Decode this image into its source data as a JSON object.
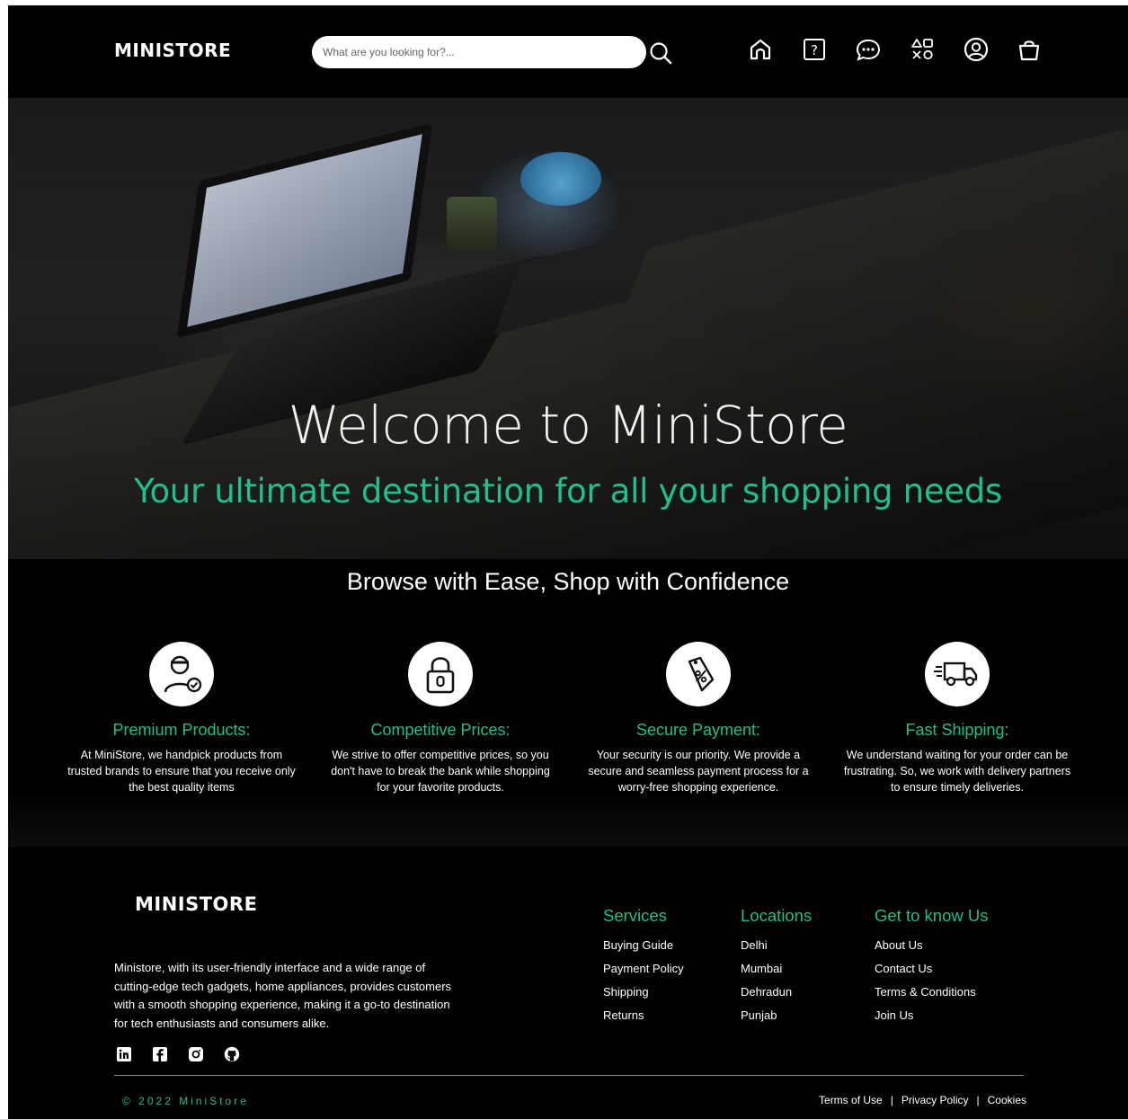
{
  "header": {
    "logo": "MINISTORE",
    "search": {
      "placeholder": "What are you looking for?...",
      "value": ""
    },
    "icons": [
      "home-icon",
      "help-icon",
      "chat-icon",
      "categories-icon",
      "account-icon",
      "cart-icon"
    ]
  },
  "hero": {
    "title": "Welcome to MiniStore",
    "subtitle": "Your ultimate destination for all your shopping needs"
  },
  "features": {
    "title": "Browse with Ease, Shop with Confidence",
    "items": [
      {
        "icon": "worker-icon",
        "title": "Premium Products:",
        "desc": "At MiniStore, we handpick products from trusted brands to ensure that you receive only the best quality items"
      },
      {
        "icon": "lock-icon",
        "title": "Competitive Prices:",
        "desc": "We strive to offer competitive prices, so you don't have to break the bank while shopping for your favorite products."
      },
      {
        "icon": "discount-tag-icon",
        "title": "Secure Payment:",
        "desc": "Your security is our priority. We provide a secure and seamless payment process for a worry-free shopping experience."
      },
      {
        "icon": "truck-icon",
        "title": "Fast Shipping:",
        "desc": "We understand waiting for your order can be frustrating. So, we work with delivery partners to ensure timely deliveries."
      }
    ]
  },
  "footer": {
    "logo": "MINISTORE",
    "about": "Ministore, with its user-friendly interface and a wide range of cutting-edge tech gadgets, home appliances, provides customers with a smooth shopping experience, making it a go-to destination for tech enthusiasts and consumers alike.",
    "socials": [
      "linkedin-icon",
      "facebook-icon",
      "instagram-icon",
      "github-icon"
    ],
    "columns": [
      {
        "title": "Services",
        "links": [
          "Buying Guide",
          "Payment Policy",
          "Shipping",
          "Returns"
        ]
      },
      {
        "title": "Locations",
        "links": [
          "Delhi",
          "Mumbai",
          "Dehradun",
          "Punjab"
        ]
      },
      {
        "title": "Get to know Us",
        "links": [
          "About Us",
          "Contact Us",
          "Terms & Conditions",
          "Join Us"
        ]
      }
    ],
    "copyright": "© 2022 MiniStore",
    "legal": [
      "Terms of Use",
      "Privacy Policy",
      "Cookies"
    ],
    "legal_separator": "|"
  },
  "colors": {
    "accent": "#1fbf8f",
    "background": "#000000",
    "text": "#ffffff"
  }
}
